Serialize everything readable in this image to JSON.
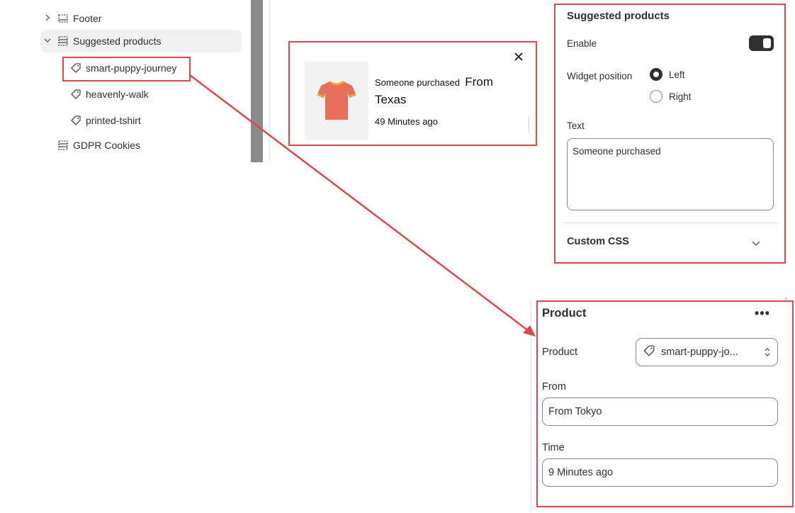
{
  "sidebar": {
    "items": [
      {
        "label": "Footer",
        "icon": "section-icon",
        "expander": "chevron-right"
      },
      {
        "label": "Suggested products",
        "icon": "section-icon",
        "expander": "chevron-down"
      },
      {
        "label": "smart-puppy-journey",
        "icon": "tag-icon"
      },
      {
        "label": "heavenly-walk",
        "icon": "tag-icon"
      },
      {
        "label": "printed-tshirt",
        "icon": "tag-icon"
      },
      {
        "label": "GDPR Cookies",
        "icon": "section-icon"
      }
    ]
  },
  "toast": {
    "text": "Someone purchased",
    "from": "From",
    "location": "Texas",
    "time": "49 Minutes ago",
    "image": "t-shirt"
  },
  "settings": {
    "title": "Suggested products",
    "enable_label": "Enable",
    "enable_on": true,
    "position_label": "Widget position",
    "position_options": [
      "Left",
      "Right"
    ],
    "position_selected": "Left",
    "text_label": "Text",
    "text_value": "Someone purchased",
    "custom_css_label": "Custom CSS"
  },
  "product_block": {
    "title": "Product",
    "product_label": "Product",
    "product_value": "smart-puppy-jo...",
    "from_label": "From",
    "from_value": "From Tokyo",
    "time_label": "Time",
    "time_value": "9 Minutes ago"
  },
  "colors": {
    "highlight": "#e0464a",
    "text": "#303030",
    "toggle_on": "#303030",
    "shirt": "#e86f5c"
  }
}
